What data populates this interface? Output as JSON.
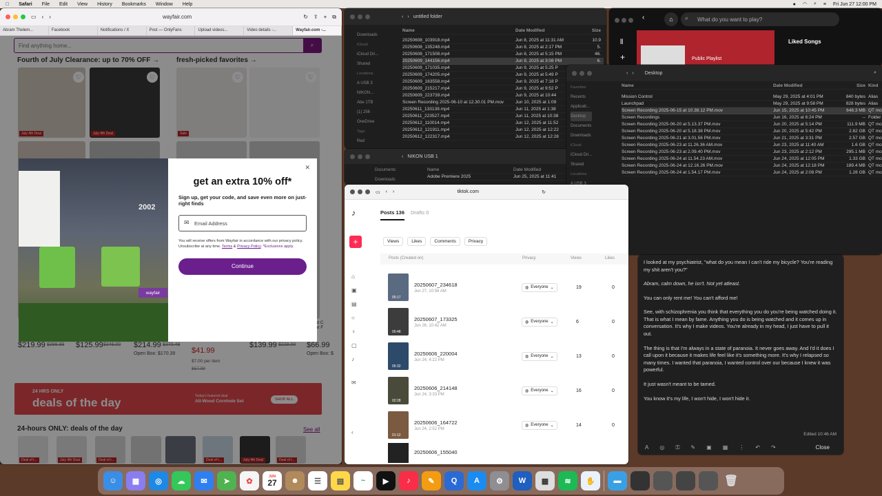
{
  "menubar": {
    "app": "Safari",
    "items": [
      "File",
      "Edit",
      "View",
      "History",
      "Bookmarks",
      "Window",
      "Help"
    ],
    "datetime": "Fri Jun 27 12:00 PM"
  },
  "safari": {
    "url": "wayfair.com",
    "tabs": [
      "Abram Thelem...",
      "Facebook",
      "Notifications / X",
      "Post — OnlyFans",
      "Upload videos...",
      "Video details -...",
      "Wayfair.com -..."
    ]
  },
  "wayfair": {
    "search_placeholder": "Find anything home...",
    "section1": "Fourth of July Clearance: up to 70% OFF →",
    "section2": "fresh-picked favorites →",
    "badge_july": "July 4th Deal",
    "badge_sale": "Sale",
    "prices": [
      "$219.99",
      "$125.99",
      "$214.99",
      "$139.99",
      "$66.99"
    ],
    "old_prices": [
      "$399.99",
      "$349.00",
      "$370.49",
      "$229.00",
      "$110.49"
    ],
    "open_box1": "Open Box: $170.39",
    "open_box2": "Open Box: $",
    "price_main": "$41.99",
    "per_item": "$7.00 per item",
    "strike_price": "$57.99",
    "deals_small": "24 HRS ONLY",
    "deals_big": "deals of the day",
    "deals_todays": "Today's featured deal",
    "deals_item": "All-Wood Cornhole Set",
    "deals_shop": "SHOP ALL",
    "hrs_title": "24-hours ONLY: deals of the day",
    "see_all": "See all",
    "deal_of": "Deal of t...",
    "side_text": "ipered C\nur Mat F"
  },
  "modal": {
    "title": "get an extra 10% off*",
    "subtitle": "Sign up, get your code, and save even more on just-right finds",
    "email_placeholder": "Email Address",
    "fine_print": "You will receive offers from Wayfair in accordance with our privacy policy. Unsubscribe at any time. ",
    "terms": "Terms",
    "amp": " & ",
    "privacy": "Privacy Policy",
    "exclusions": ". *Exclusions apply.",
    "continue": "Continue",
    "porch_number": "2002",
    "sign": "wayfair"
  },
  "finder1": {
    "title": "untitled folder",
    "col_name": "Name",
    "col_date": "Date Modified",
    "col_size": "Size",
    "sidebar": [
      "Downloads",
      "iCloud",
      "iCloud Dri...",
      "Shared",
      "Locations",
      "A USB 3",
      "NIKON...",
      "Abe 1TB",
      "(1) 256",
      "OneDrive",
      "Tags",
      "Red"
    ],
    "rows": [
      [
        "20250608_103918.mp4",
        "Jun 8, 2025 at 11:31 AM",
        "10.9"
      ],
      [
        "20250608_135248.mp4",
        "Jun 8, 2025 at 2:17 PM",
        "5."
      ],
      [
        "20250608_171508.mp4",
        "Jun 8, 2025 at 5:15 PM",
        "46."
      ],
      [
        "20250609_144156.mp4",
        "Jun 9, 2025 at 3:08 PM",
        "6."
      ],
      [
        "20250609_171035.mp4",
        "Jun 9, 2025 at 5:25 P",
        ""
      ],
      [
        "20250609_174205.mp4",
        "Jun 9, 2025 at 5:49 P",
        ""
      ],
      [
        "20250609_183558.mp4",
        "Jun 9, 2025 at 7:18 P",
        ""
      ],
      [
        "20250609_215217.mp4",
        "Jun 9, 2025 at 9:52 P",
        ""
      ],
      [
        "20250609_223739.mp4",
        "Jun 9, 2025 at 10:44",
        ""
      ],
      [
        "Screen Recording 2025-06-10 at 12.30.01 PM.mov",
        "Jun 10, 2025 at 1:09",
        ""
      ],
      [
        "20250611_133139.mp4",
        "Jun 11, 2025 at 1:38",
        ""
      ],
      [
        "20250611_223527.mp4",
        "Jun 11, 2025 at 10:38",
        ""
      ],
      [
        "20250612_110014.mp4",
        "Jun 12, 2025 at 11:52",
        ""
      ],
      [
        "20250612_121911.mp4",
        "Jun 12, 2025 at 12:22",
        ""
      ],
      [
        "20250612_122317.mp4",
        "Jun 12, 2025 at 12:28",
        ""
      ]
    ]
  },
  "finder2": {
    "title": "NIKON USB 1",
    "col_name": "Name",
    "col_date": "Date Modified",
    "row": "Adobe Premiere 2025",
    "row_date": "Jun 25, 2025 at 11:41",
    "sidebar": [
      "Documents",
      "Downloads"
    ]
  },
  "finder3": {
    "title": "Desktop",
    "col_name": "Name",
    "col_date": "Date Modified",
    "col_size": "Size",
    "col_kind": "Kind",
    "sidebar": [
      "Favorites",
      "Recents",
      "Applicati...",
      "Desktop",
      "Documents",
      "Downloads",
      "iCloud",
      "iCloud Dri...",
      "Shared",
      "Locations",
      "A USB 3",
      "NIKON...",
      "Abe 1TB",
      "(1) 256",
      "OneDrive",
      "Tags",
      "Red",
      "Orange"
    ],
    "rows": [
      [
        "Mission Control",
        "May 29, 2025 at 4:01 PM",
        "840 bytes",
        "Alias"
      ],
      [
        "Launchpad",
        "May 29, 2025 at 9:58 PM",
        "828 bytes",
        "Alias"
      ],
      [
        "Screen Recording 2025-06-15 at 10.38.12 PM.mov",
        "Jun 15, 2025 at 10:45 PM",
        "648.3 MB",
        "QT mo"
      ],
      [
        "Screen Recordings",
        "Jun 16, 2025 at 6:24 PM",
        "--",
        "Folder"
      ],
      [
        "Screen Recording 2025-06-20 at 5.13.37 PM.mov",
        "Jun 20, 2025 at 5:14 PM",
        "111.9 MB",
        "QT mo"
      ],
      [
        "Screen Recording 2025-06-20 at 5.18.38 PM.mov",
        "Jun 20, 2025 at 5:42 PM",
        "2.82 GB",
        "QT mo"
      ],
      [
        "Screen Recording 2025-06-21 at 3.01.56 PM.mov",
        "Jun 21, 2025 at 3:31 PM",
        "2.57 GB",
        "QT mo"
      ],
      [
        "Screen Recording 2025-06-23 at 11.26.36 AM.mov",
        "Jun 23, 2025 at 11:40 AM",
        "1.6 GB",
        "QT mo"
      ],
      [
        "Screen Recording 2025-06-23 at 2.09.40 PM.mov",
        "Jun 23, 2025 at 2:12 PM",
        "295.1 MB",
        "QT mo"
      ],
      [
        "Screen Recording 2025-06-24 at 11.54.23 AM.mov",
        "Jun 24, 2025 at 12:05 PM",
        "1.33 GB",
        "QT mo"
      ],
      [
        "Screen Recording 2025-06-24 at 12.16.26 PM.mov",
        "Jun 24, 2025 at 12:18 PM",
        "189.4 MB",
        "QT mo"
      ],
      [
        "Screen Recording 2025-06-24 at 1.54.17 PM.mov",
        "Jun 24, 2025 at 2:08 PM",
        "1.28 GB",
        "QT mo"
      ]
    ]
  },
  "spotify": {
    "search": "What do you want to play?",
    "playlist": "Public Playlist",
    "liked": "Liked Songs"
  },
  "tiktok": {
    "url": "tiktok.com",
    "tab_posts": "Posts 136",
    "tab_drafts": "Drafts 0",
    "filters": [
      "Views",
      "Likes",
      "Comments",
      "Privacy"
    ],
    "col_posts": "Posts (Created on)",
    "col_privacy": "Privacy",
    "col_views": "Views",
    "col_likes": "Likes",
    "rows": [
      {
        "title": "20250607_234618",
        "date": "Jun 27, 10:56 AM",
        "dur": "05:17",
        "privacy": "Everyone",
        "views": "19",
        "likes": "0"
      },
      {
        "title": "20250607_173325",
        "date": "Jun 26, 10:42 AM",
        "dur": "00:48",
        "privacy": "Everyone",
        "views": "6",
        "likes": "0"
      },
      {
        "title": "20250606_220004",
        "date": "Jun 24, 4:22 PM",
        "dur": "05:32",
        "privacy": "Everyone",
        "views": "13",
        "likes": "0"
      },
      {
        "title": "20250606_214148",
        "date": "Jun 24, 3:33 PM",
        "dur": "02:28",
        "privacy": "Everyone",
        "views": "16",
        "likes": "0"
      },
      {
        "title": "20250606_164722",
        "date": "Jun 24, 2:52 PM",
        "dur": "01:12",
        "privacy": "Everyone",
        "views": "14",
        "likes": "0"
      },
      {
        "title": "20250606_155040",
        "date": "",
        "dur": "",
        "privacy": "",
        "views": "",
        "likes": ""
      }
    ]
  },
  "notes": {
    "paragraphs": [
      "I looked at my psychiatrist, \"what do you mean I can't ride my bicycle? You're reading my shit aren't you?\"",
      "Abram, calm down, he isn't. Not yet atleast.",
      "You can only rent me! You can't afford me!",
      "See, with schizophrenia you think that everything you do you're being watched doing it. That is what I mean by fame. Anything you do is being watched and it comes up in conversation. It's why I make videos. You're already in my head, I just have to pull it out.",
      "The thing is that I'm always in a state of paranoia. It never goes away. And I'd it does I call upon it because it makes life feel like it's something more. It's why I relapsed so many times. I wanted that paranoia, I wanted control over our because I knew it was powerful.",
      "It just wasn't meant to be tamed.",
      "You know it's my life, I won't hide, I won't hide it."
    ],
    "edited": "Edited 10:46 AM",
    "close": "Close"
  },
  "dock": {
    "calendar_month": "JUN",
    "calendar_day": "27"
  }
}
